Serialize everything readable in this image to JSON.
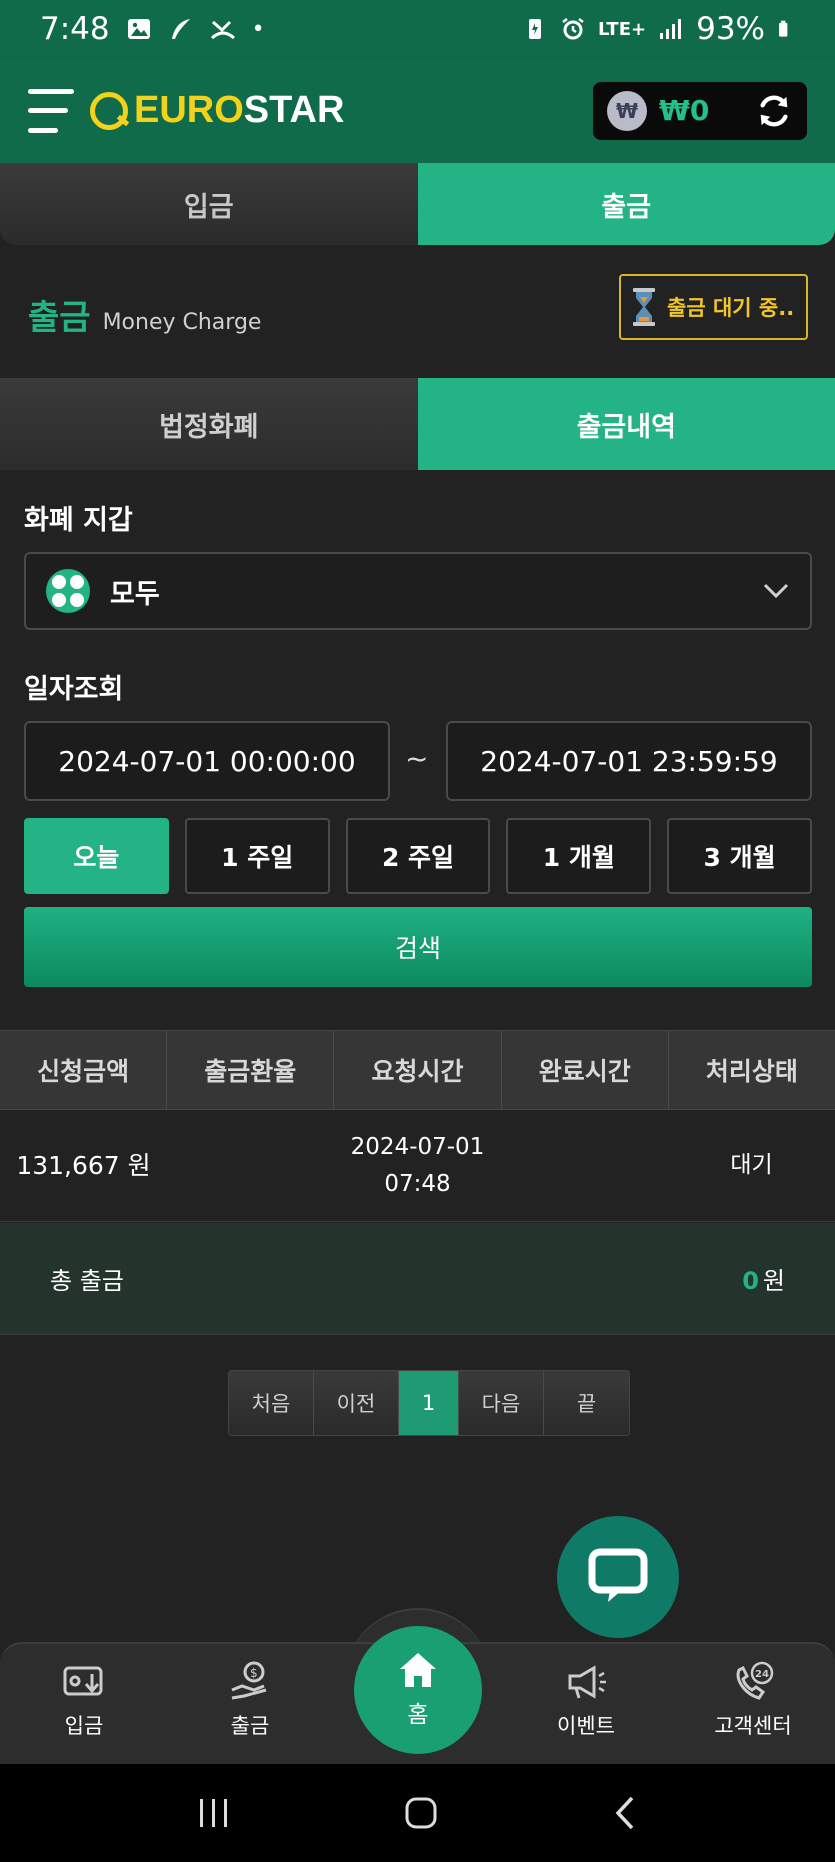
{
  "status": {
    "time": "7:48",
    "dot": "•",
    "network": "LTE+",
    "battery": "93%"
  },
  "header": {
    "logo_euro": "EURO",
    "logo_star": "STAR",
    "wallet_symbol": "₩",
    "wallet_amount": "₩0"
  },
  "top_tabs": [
    {
      "label": "입금"
    },
    {
      "label": "출금"
    }
  ],
  "section": {
    "title": "출금",
    "subtitle": "Money Charge",
    "pending_label": "출금 대기 중.."
  },
  "sub_tabs": [
    {
      "label": "법정화폐"
    },
    {
      "label": "출금내역"
    }
  ],
  "wallet_filter": {
    "label": "화폐 지갑",
    "selected": "모두"
  },
  "date_filter": {
    "label": "일자조회",
    "start": "2024-07-01 00:00:00",
    "separator": "~",
    "end": "2024-07-01 23:59:59"
  },
  "periods": [
    {
      "label": "오늘"
    },
    {
      "label": "1 주일"
    },
    {
      "label": "2 주일"
    },
    {
      "label": "1 개월"
    },
    {
      "label": "3 개월"
    }
  ],
  "search_label": "검색",
  "table": {
    "headers": [
      "신청금액",
      "출금환율",
      "요청시간",
      "완료시간",
      "처리상태"
    ],
    "rows": [
      {
        "amount": "131,667 원",
        "rate": "",
        "request_date": "2024-07-01",
        "request_time": "07:48",
        "complete": "",
        "status": "대기"
      }
    ]
  },
  "total": {
    "label": "총 출금",
    "value": "0",
    "unit": "원"
  },
  "pager": [
    "처음",
    "이전",
    "1",
    "다음",
    "끝"
  ],
  "bottom_nav": {
    "deposit": "입금",
    "withdraw": "출금",
    "home": "홈",
    "event": "이벤트",
    "support": "고객센터"
  },
  "colors": {
    "accent": "#23b384",
    "header": "#0f6b4a",
    "warning": "#d9b52a",
    "background": "#222222"
  }
}
